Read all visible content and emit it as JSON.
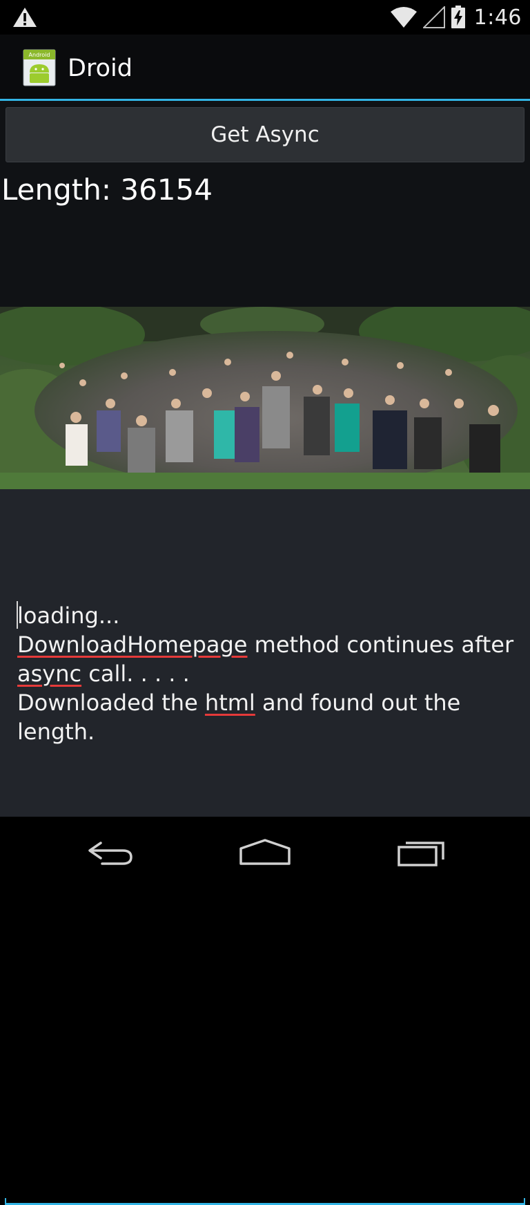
{
  "status_bar": {
    "time": "1:46",
    "icons": [
      "warning-icon",
      "wifi-icon",
      "signal-icon",
      "battery-charging-icon"
    ]
  },
  "action_bar": {
    "app_icon": "android-app-icon",
    "app_icon_text": "Android",
    "title": "Droid",
    "accent_color": "#33b5e5"
  },
  "main": {
    "button_label": "Get Async",
    "length_label": "Length: 36154",
    "photo": "group-photo",
    "log_lines": [
      {
        "parts": [
          {
            "text": "loading...",
            "spell": false
          }
        ]
      },
      {
        "parts": [
          {
            "text": "DownloadHomepage",
            "spell": true
          },
          {
            "text": " method continues after",
            "spell": false
          }
        ]
      },
      {
        "parts": [
          {
            "text": "async",
            "spell": true
          },
          {
            "text": " call. . . . .",
            "spell": false
          }
        ]
      },
      {
        "parts": [
          {
            "text": "Downloaded the ",
            "spell": false
          },
          {
            "text": "html",
            "spell": true
          },
          {
            "text": " and found out the",
            "spell": false
          }
        ]
      },
      {
        "parts": [
          {
            "text": "length.",
            "spell": false
          }
        ]
      }
    ]
  },
  "nav_bar": {
    "icons": [
      "back-icon",
      "home-icon",
      "recents-icon"
    ]
  }
}
